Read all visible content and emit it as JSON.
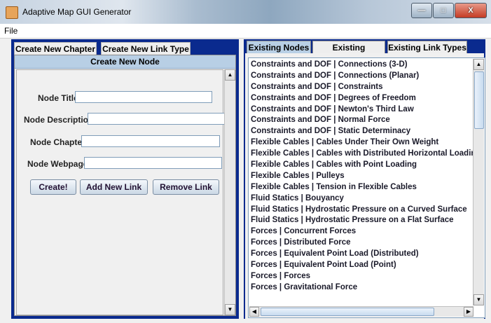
{
  "window": {
    "title": "Adaptive Map GUI Generator",
    "minimize": "—",
    "maximize": "□",
    "close": "X"
  },
  "menu": {
    "file": "File"
  },
  "left": {
    "tabs": [
      "Create New Chapter",
      "Create New Link Type"
    ],
    "active_tab": "Create New Node",
    "form": {
      "node_title_label": "Node Title",
      "node_title_value": "",
      "node_description_label": "Node Description",
      "node_description_value": "",
      "node_chapter_label": "Node Chapter",
      "node_chapter_value": "",
      "node_webpage_label": "Node Webpage",
      "node_webpage_value": ""
    },
    "buttons": {
      "create": "Create!",
      "add_link": "Add New Link",
      "remove_link": "Remove Link"
    }
  },
  "right": {
    "tabs": [
      "Existing Nodes",
      "Existing Chapters",
      "Existing Link Types"
    ],
    "active_tab_index": 0,
    "nodes": [
      "Constraints and DOF | Connections (3-D)",
      "Constraints and DOF | Connections (Planar)",
      "Constraints and DOF | Constraints",
      "Constraints and DOF | Degrees of Freedom",
      "Constraints and DOF | Newton's Third Law",
      "Constraints and DOF | Normal Force",
      "Constraints and DOF | Static Determinacy",
      "Flexible Cables | Cables Under Their Own Weight",
      "Flexible Cables | Cables with Distributed Horizontal Loading",
      "Flexible Cables | Cables with Point Loading",
      "Flexible Cables | Pulleys",
      "Flexible Cables | Tension in Flexible Cables",
      "Fluid Statics | Bouyancy",
      "Fluid Statics | Hydrostatic Pressure on a Curved Surface",
      "Fluid Statics | Hydrostatic Pressure on a Flat Surface",
      "Forces | Concurrent Forces",
      "Forces | Distributed Force",
      "Forces | Equivalent Point Load (Distributed)",
      "Forces | Equivalent Point Load (Point)",
      "Forces | Forces",
      "Forces | Gravitational Force"
    ]
  },
  "icons": {
    "app": "java-app-icon",
    "scroll_up": "scroll-up-arrow-icon",
    "scroll_down": "scroll-down-arrow-icon",
    "scroll_left": "scroll-left-arrow-icon",
    "scroll_right": "scroll-right-arrow-icon",
    "grip": "scroll-grip-icon"
  },
  "colors": {
    "panel_bg": "#0a2a8e",
    "active_tab": "#b8cfe5",
    "window_bg": "#f0f0f0"
  }
}
